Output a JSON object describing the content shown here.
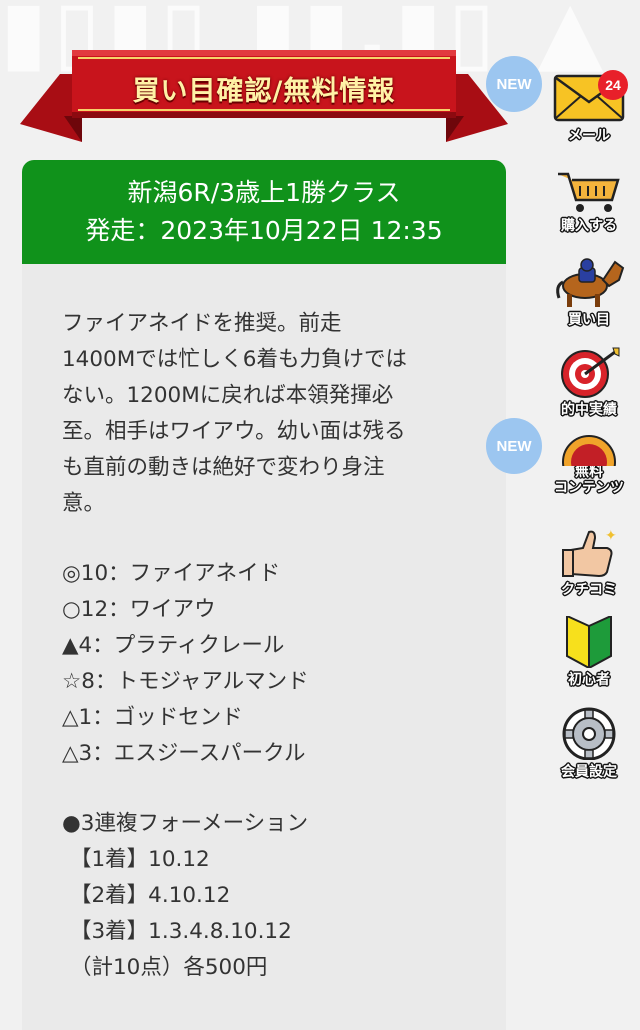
{
  "banner": {
    "title": "買い目確認/無料情報"
  },
  "race": {
    "name": "新潟6R/3歳上1勝クラス",
    "start": "発走：2023年10月22日 12:35"
  },
  "comment": "ファイアネイドを推奨。前走\n1400Mでは忙しく6着も力負けでは\nない。1200Mに戻れば本領発揮必\n至。相手はワイアウ。幼い面は残る\nも直前の動きは絶好で変わり身注\n意。",
  "picks": [
    "◎10：ファイアネイド",
    "○12：ワイアウ",
    "▲4：プラティクレール",
    "☆8：トモジャアルマンド",
    "△1：ゴッドセンド",
    "△3：エスジースパークル"
  ],
  "formation": {
    "title": "●3連複フォーメーション",
    "rows": [
      "【1着】10.12",
      "【2着】4.10.12",
      "【3着】1.3.4.8.10.12"
    ],
    "total": "（計10点）各500円"
  },
  "sidebar": {
    "items": [
      {
        "label": "メール",
        "icon": "mail-icon",
        "badge_new": "NEW",
        "count": "24"
      },
      {
        "label": "購入する",
        "icon": "cart-icon"
      },
      {
        "label": "買い目",
        "icon": "horse-icon"
      },
      {
        "label": "的中実績",
        "icon": "target-icon"
      },
      {
        "label": "無料\nコンテンツ",
        "icon": "medal-icon",
        "badge_new": "NEW"
      },
      {
        "label": "クチコミ",
        "icon": "thumbs-up-icon"
      },
      {
        "label": "初心者",
        "icon": "beginner-mark-icon"
      },
      {
        "label": "会員設定",
        "icon": "gear-icon"
      }
    ]
  },
  "colors": {
    "header_green": "#10921b",
    "ribbon_red": "#c8141c",
    "card_bg": "#eaeaea",
    "badge_blue": "#9cc6f0",
    "badge_red": "#e8202a"
  }
}
